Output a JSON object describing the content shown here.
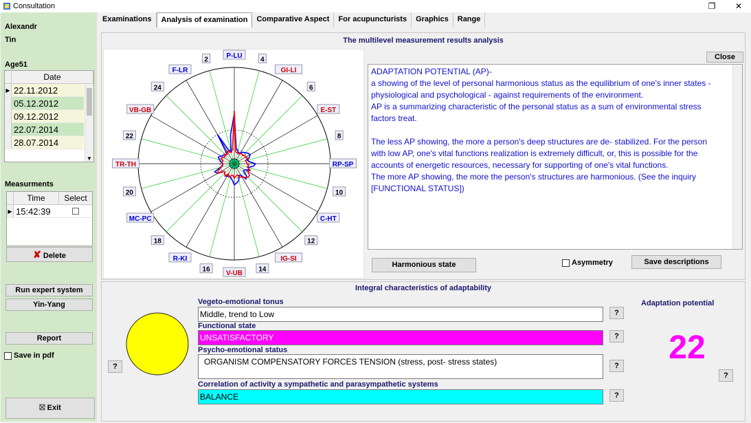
{
  "window": {
    "title": "Consultation",
    "restore_icon": "restore-icon",
    "close_icon": "close-icon",
    "restore_glyph": "❐",
    "close_glyph": "✕"
  },
  "patient": {
    "first_name": "Alexandr",
    "last_name": "Tin",
    "age_label": "Age51"
  },
  "dates": {
    "header": "Date",
    "rows": [
      "22.11.2012",
      "05.12.2012",
      "09.12.2012",
      "22.07.2014",
      "28.07.2014"
    ]
  },
  "measurements": {
    "label": "Measurments",
    "time_header": "Time",
    "select_header": "Select",
    "rows": [
      {
        "time": "15:42:39"
      }
    ]
  },
  "left_buttons": {
    "delete": "Delete",
    "run_expert": "Run expert system",
    "yin_yang": "Yin-Yang",
    "report": "Report",
    "save_pdf": "Save in pdf",
    "exit": "Exit"
  },
  "tabs": [
    "Examinations",
    "Analysis of examination",
    "Comparative Aspect",
    "For acupuncturists",
    "Graphics",
    "Range"
  ],
  "analysis": {
    "title": "The multilevel measurement results analysis",
    "close": "Close",
    "desc_lines": [
      "ADAPTATION POTENTIAL (AP)-",
      "a showing of the level of personal harmonious status as the equilibrium of one's inner states -",
      "physiological and psychological - against  requirements of the environment.",
      "AP is a summarizing characteristic of the personal status as a sum of environmental stress",
      "factors treat.",
      "",
      "The less AP showing, the more a person's deep structures are de- stabilized. For the person",
      "with low AP, one's vital functions realization is extremely difficult, or, this is possible for the",
      "accounts of energetic resources, necessary for supporting of one's vital functions.",
      "The more AP showing, the more the person's structures are  harmonious. (See the inquiry",
      "[FUNCTIONAL  STATUS])"
    ],
    "harmonious": "Harmonious state",
    "asymmetry": "Asymmetry",
    "save_desc": "Save descriptions"
  },
  "integral": {
    "title": "Integral characteristics of adaptability",
    "vegeto_label": "Vegeto-emotional tonus",
    "vegeto_value": "Middle, trend to Low",
    "functional_label": "Functional state",
    "functional_value": "UNSATISFACTORY",
    "psycho_label": "Psycho-emotional status",
    "psycho_value": "ORGANISM COMPENSATORY FORCES TENSION (stress, post- stress states)",
    "correlation_label": "Correlation of activity a sympathetic and parasympathetic systems",
    "correlation_value": "BALANCE",
    "ap_label": "Adaptation potential",
    "ap_value": "22",
    "q": "?",
    "colors": {
      "functional": "#ff00ff",
      "correlation": "#00ffff",
      "ap": "#ff00ff",
      "circle": "#ffff00"
    }
  },
  "chart_data": {
    "type": "radar",
    "labels": [
      {
        "text": "P-LU",
        "color": "#0000cc"
      },
      {
        "text": "4",
        "color": "#000"
      },
      {
        "text": "GI-LI",
        "color": "#cc0000"
      },
      {
        "text": "6",
        "color": "#000"
      },
      {
        "text": "E-ST",
        "color": "#cc0000"
      },
      {
        "text": "8",
        "color": "#000"
      },
      {
        "text": "RP-SP",
        "color": "#0000cc"
      },
      {
        "text": "10",
        "color": "#000"
      },
      {
        "text": "C-HT",
        "color": "#0000cc"
      },
      {
        "text": "12",
        "color": "#000"
      },
      {
        "text": "IG-SI",
        "color": "#cc0000"
      },
      {
        "text": "14",
        "color": "#000"
      },
      {
        "text": "V-UB",
        "color": "#cc0000"
      },
      {
        "text": "16",
        "color": "#000"
      },
      {
        "text": "R-KI",
        "color": "#0000cc"
      },
      {
        "text": "18",
        "color": "#000"
      },
      {
        "text": "MC-PC",
        "color": "#0000cc"
      },
      {
        "text": "20",
        "color": "#000"
      },
      {
        "text": "TR-TH",
        "color": "#cc0000"
      },
      {
        "text": "22",
        "color": "#000"
      },
      {
        "text": "VB-GB",
        "color": "#cc0000"
      },
      {
        "text": "24",
        "color": "#000"
      },
      {
        "text": "F-LR",
        "color": "#0000cc"
      },
      {
        "text": "2",
        "color": "#000"
      }
    ],
    "series": [
      {
        "color": "#0000ff",
        "values": [
          0.52,
          0.16,
          0.14,
          0.12,
          0.13,
          0.15,
          0.16,
          0.18,
          0.19,
          0.17,
          0.14,
          0.16,
          0.22,
          0.2,
          0.15,
          0.17,
          0.13,
          0.12,
          0.18,
          0.2,
          0.14,
          0.13,
          0.18,
          0.2,
          0.22,
          0.17,
          0.15,
          0.14,
          0.15,
          0.16,
          0.14,
          0.13,
          0.2,
          0.22,
          0.15,
          0.12,
          0.12,
          0.14,
          0.16,
          0.18,
          0.16,
          0.14,
          0.13,
          0.12,
          0.35,
          0.15,
          0.13,
          0.3
        ]
      },
      {
        "color": "#ff0000",
        "values": [
          0.55,
          0.12,
          0.12,
          0.11,
          0.12,
          0.13,
          0.12,
          0.14,
          0.13,
          0.15,
          0.12,
          0.13,
          0.13,
          0.15,
          0.14,
          0.18,
          0.16,
          0.2,
          0.2,
          0.18,
          0.16,
          0.15,
          0.12,
          0.13,
          0.15,
          0.12,
          0.13,
          0.15,
          0.12,
          0.16,
          0.14,
          0.13,
          0.2,
          0.18,
          0.14,
          0.13,
          0.12,
          0.13,
          0.12,
          0.15,
          0.13,
          0.12,
          0.14,
          0.12,
          0.15,
          0.13,
          0.12,
          0.15
        ]
      }
    ]
  }
}
